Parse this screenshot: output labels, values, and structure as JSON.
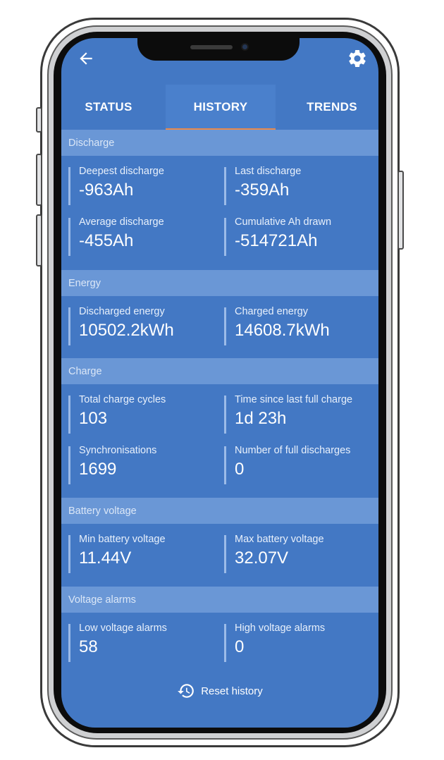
{
  "tabs": [
    {
      "label": "STATUS"
    },
    {
      "label": "HISTORY"
    },
    {
      "label": "TRENDS"
    }
  ],
  "active_tab": "HISTORY",
  "accent_color": "#e98a4c",
  "background_color": "#4378c4",
  "sections": [
    {
      "title": "Discharge",
      "stats": [
        {
          "label": "Deepest discharge",
          "value": "-963Ah"
        },
        {
          "label": "Last discharge",
          "value": "-359Ah"
        },
        {
          "label": "Average discharge",
          "value": "-455Ah"
        },
        {
          "label": "Cumulative Ah drawn",
          "value": "-514721Ah"
        }
      ]
    },
    {
      "title": "Energy",
      "stats": [
        {
          "label": "Discharged energy",
          "value": "10502.2kWh"
        },
        {
          "label": "Charged energy",
          "value": "14608.7kWh"
        }
      ]
    },
    {
      "title": "Charge",
      "stats": [
        {
          "label": "Total charge cycles",
          "value": "103"
        },
        {
          "label": "Time since last full charge",
          "value": "1d 23h"
        },
        {
          "label": "Synchronisations",
          "value": "1699"
        },
        {
          "label": "Number of full discharges",
          "value": "0"
        }
      ]
    },
    {
      "title": "Battery voltage",
      "stats": [
        {
          "label": "Min battery voltage",
          "value": "11.44V"
        },
        {
          "label": "Max battery voltage",
          "value": "32.07V"
        }
      ]
    },
    {
      "title": "Voltage alarms",
      "stats": [
        {
          "label": "Low voltage alarms",
          "value": "58"
        },
        {
          "label": "High voltage alarms",
          "value": "0"
        }
      ]
    }
  ],
  "reset_label": "Reset history",
  "icons": {
    "back": "arrow-left-icon",
    "settings": "gear-icon",
    "reset": "history-icon"
  }
}
